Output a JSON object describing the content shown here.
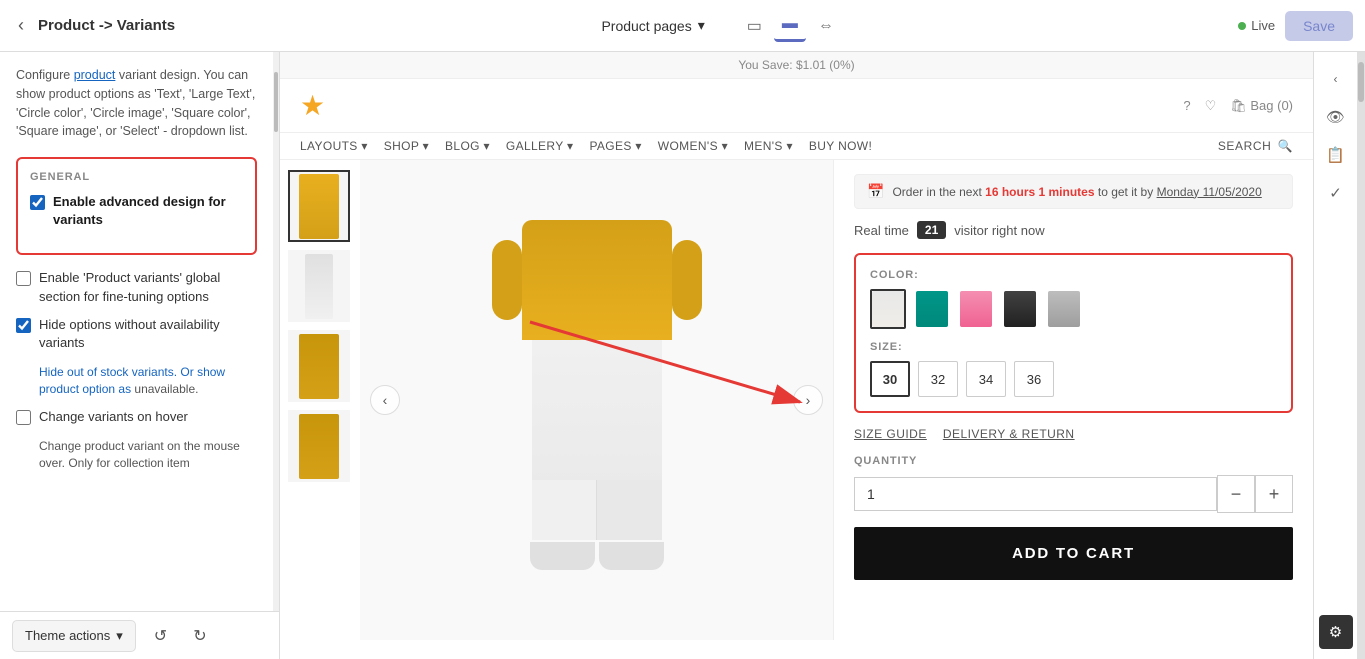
{
  "topbar": {
    "back_icon": "‹",
    "title": "Product -> Variants",
    "page_selector_label": "Product pages",
    "chevron": "▾",
    "view_mobile_icon": "▭",
    "view_desktop_icon": "▬",
    "view_wide_icon": "⇔",
    "live_label": "Live",
    "save_label": "Save"
  },
  "left_panel": {
    "description": "Configure product variant design. You can show product options as 'Text', 'Large Text', 'Circle color', 'Circle image', 'Square color', 'Square image', or 'Select' - dropdown list.",
    "description_highlight": "product",
    "general_label": "GENERAL",
    "checkboxes": [
      {
        "id": "enable-advanced",
        "label": "Enable advanced design for variants",
        "checked": true,
        "sub_text": null
      },
      {
        "id": "enable-global",
        "label": "Enable 'Product variants' global section for fine-tuning options",
        "checked": false,
        "sub_text": null
      },
      {
        "id": "hide-unavailable",
        "label": "Hide options without availability variants",
        "checked": true,
        "sub_text": "Hide out of stock variants. Or show product option as unavailable."
      },
      {
        "id": "change-on-hover",
        "label": "Change variants on hover",
        "checked": false,
        "sub_text": "Change product variant on the mouse over. Only for collection item"
      }
    ]
  },
  "bottom_bar": {
    "theme_actions_label": "Theme actions",
    "chevron": "▾",
    "undo_icon": "↺",
    "redo_icon": "↻"
  },
  "store": {
    "topbar_text": "You Save: $1.01 (0%)",
    "header_icons": [
      "?",
      "♡",
      "🛍 Bag (0)"
    ],
    "logo_star": "★",
    "nav_items": [
      "LAYOUTS ▾",
      "SHOP ▾",
      "BLOG ▾",
      "GALLERY ▾",
      "PAGES ▾",
      "WOMEN'S ▾",
      "MEN'S ▾",
      "BUY NOW!"
    ],
    "search_label": "SEARCH",
    "order_banner": "Order in the next 16 hours 1 minutes to get it by Monday 11/05/2020",
    "order_time_highlight": "16 hours 1 minutes",
    "order_date_highlight": "Monday 11/05/2020",
    "realtime_label": "Real time",
    "visitor_count": "21",
    "visitor_suffix": "visitor right now",
    "color_label": "COLOR:",
    "size_label": "SIZE:",
    "sizes": [
      "30",
      "32",
      "34",
      "36"
    ],
    "selected_size": "30",
    "size_guide_label": "SIZE GUIDE",
    "delivery_label": "DELIVERY & RETURN",
    "quantity_label": "QUANTITY",
    "quantity_value": "1",
    "minus_label": "−",
    "plus_label": "+",
    "add_to_cart_label": "ADD TO CART"
  },
  "right_sidebar_icons": [
    "‹",
    "👁",
    "🛍",
    "✓",
    "⚙"
  ]
}
